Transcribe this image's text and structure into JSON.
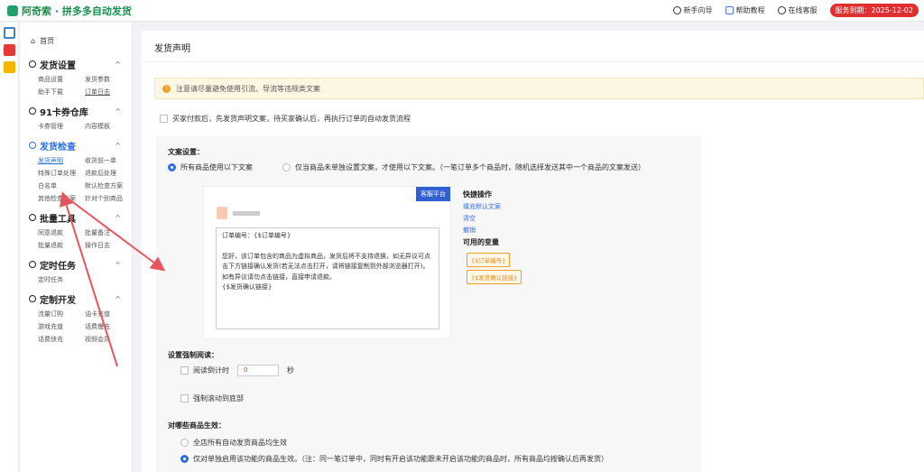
{
  "app": {
    "title": "阿奇索 · 拼多多自动发货",
    "brand_color": "#1a8f4f"
  },
  "topbar": {
    "links": [
      "新手向导",
      "帮助教程",
      "在线客服"
    ],
    "service_badge": "服务到期：2025-12-02"
  },
  "sidebar": {
    "home": "首页",
    "sections": [
      {
        "title": "发货设置",
        "items": [
          "商品设置",
          "发货参数",
          "助手下载",
          "订单日志"
        ]
      },
      {
        "title": "91卡券仓库",
        "items": [
          "卡券管理",
          "内容模板"
        ]
      },
      {
        "title": "发货检查",
        "items": [
          "发货声明",
          "收货前一单",
          "特殊订单处理",
          "退款后处理",
          "白名单",
          "默认检查方案",
          "其他检查方案",
          "针对个别商品"
        ]
      },
      {
        "title": "批量工具",
        "items": [
          "同意退款",
          "批量备注",
          "批量退款",
          "操作日志"
        ]
      },
      {
        "title": "定时任务",
        "items": [
          "定时任务"
        ]
      },
      {
        "title": "定制开发",
        "items": [
          "流量订购",
          "油卡充值",
          "游戏充值",
          "话费慢充",
          "话费快充",
          "视频会员"
        ]
      }
    ]
  },
  "main": {
    "title": "发货声明",
    "notice": "注意请尽量避免使用引流、导流等违规类文案",
    "enable_text": "买家付款后，先发货声明文案，待买家确认后，再执行订单的自动发货流程",
    "copy_setting": {
      "label": "文案设置：",
      "option_all": "所有商品使用以下文案",
      "option_single": "仅当商品未单独设置文案，才使用以下文案。（一笔订单多个商品时，随机选择发送其中一个商品的文案发送）"
    },
    "editor": {
      "service_tag": "客服平台",
      "line1": "订单编号：{$订单编号}",
      "line2": "您好，该订单包含的商品为虚拟商品，发货后将不支持退换，如无异议可点击下方链接确认发货(若无法点击打开，请将链接复制到外部浏览器打开)。如有异议请勿点击链接，直接申请退款。",
      "line3": "{$发货确认链接}"
    },
    "quick_ops": {
      "title": "快捷操作",
      "fill_default": "填充默认文案",
      "clear": "清空",
      "undo": "撤销",
      "vars_title": "可用的变量",
      "vars": [
        "{$订单编号}",
        "{$发货确认链接}"
      ]
    },
    "force_read": {
      "label": "设置强制阅读：",
      "countdown_label": "阅读倒计时",
      "countdown_value": "0",
      "unit": "秒",
      "scroll_bottom": "强制滚动到底部"
    },
    "scope": {
      "label": "对哪些商品生效：",
      "option_all": "全店所有自动发货商品均生效",
      "option_enabled": "仅对单独启用该功能的商品生效。（注：同一笔订单中，同时有开启该功能跟未开启该功能的商品时，所有商品均按确认后再发货）"
    }
  }
}
